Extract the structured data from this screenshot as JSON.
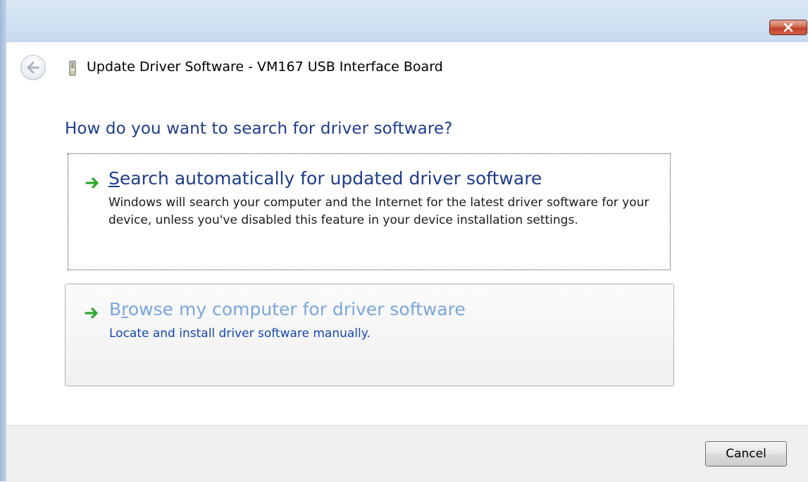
{
  "window": {
    "title": "Update Driver Software - VM167 USB Interface Board",
    "close_icon": "close-icon",
    "back_icon": "back-arrow-icon",
    "device_icon": "usb-device-icon"
  },
  "wizard": {
    "question": "How do you want to search for driver software?",
    "options": [
      {
        "icon": "green-arrow-icon",
        "title_mnemonic": "S",
        "title_rest": "earch automatically for updated driver software",
        "description": "Windows will search your computer and the Internet for the latest driver software for your device, unless you've disabled this feature in your device installation settings.",
        "focused": true
      },
      {
        "icon": "green-arrow-icon",
        "title_prefix": "B",
        "title_mnemonic": "r",
        "title_rest": "owse my computer for driver software",
        "description": "Locate and install driver software manually.",
        "hovered": true
      }
    ]
  },
  "footer": {
    "cancel_label": "Cancel"
  },
  "colors": {
    "question_text": "#1e3c8a",
    "hover_title": "#7aa6dc",
    "hover_desc": "#1546b4",
    "arrow_green": "#2fa62f"
  }
}
